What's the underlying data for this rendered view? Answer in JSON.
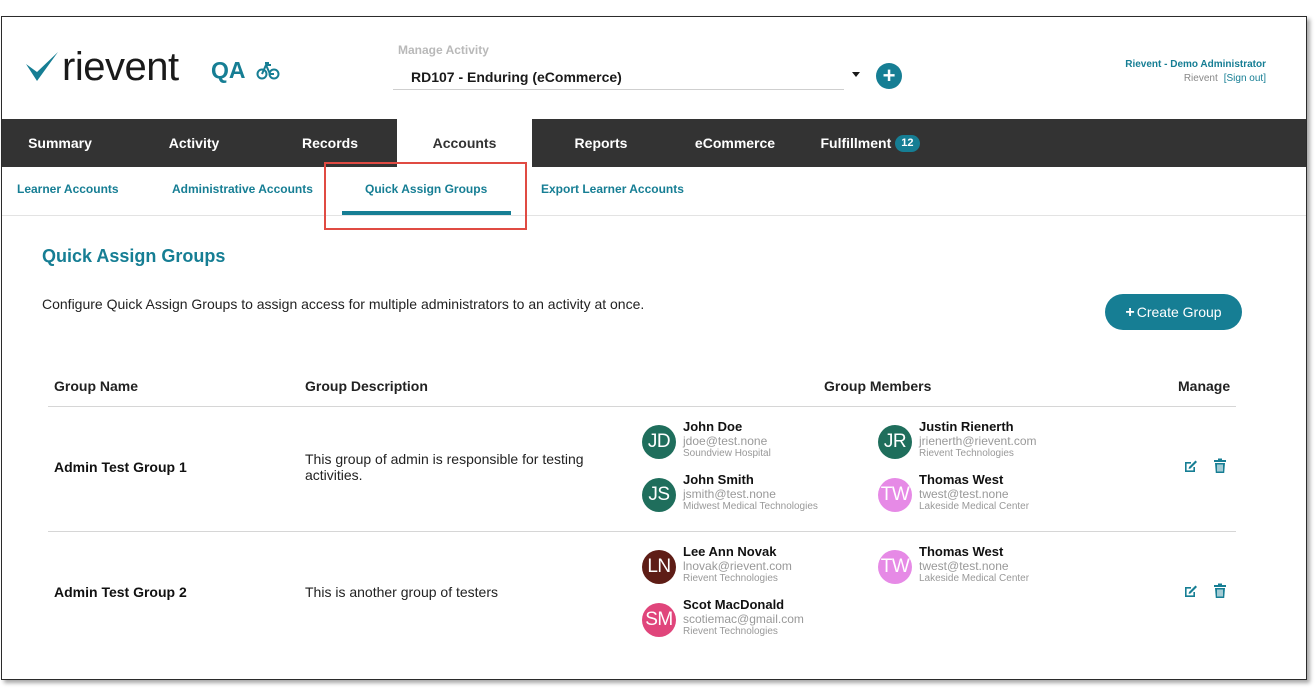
{
  "header": {
    "logo_text": "rievent",
    "environment": "QA",
    "activity_label": "Manage Activity",
    "activity_value": "RD107 - Enduring (eCommerce)",
    "user_name": "Rievent - Demo Administrator",
    "user_org": "Rievent",
    "signout": "[Sign out]"
  },
  "main_nav": {
    "tabs": [
      {
        "label": "Summary"
      },
      {
        "label": "Activity"
      },
      {
        "label": "Records"
      },
      {
        "label": "Accounts"
      },
      {
        "label": "Reports"
      },
      {
        "label": "eCommerce"
      },
      {
        "label": "Fulfillment",
        "badge": "12"
      }
    ],
    "active": "Accounts"
  },
  "sub_nav": {
    "tabs": [
      {
        "label": "Learner Accounts"
      },
      {
        "label": "Administrative Accounts"
      },
      {
        "label": "Quick Assign Groups"
      },
      {
        "label": "Export Learner Accounts"
      }
    ],
    "active": "Quick Assign Groups"
  },
  "content": {
    "title": "Quick Assign Groups",
    "description": "Configure Quick Assign Groups to assign access for multiple administrators to an activity at once.",
    "create_button": "Create Group",
    "table": {
      "headers": {
        "name": "Group Name",
        "description": "Group Description",
        "members": "Group Members",
        "manage": "Manage"
      },
      "rows": [
        {
          "name": "Admin Test Group 1",
          "description": "This group of admin is responsible for testing activities.",
          "members": [
            {
              "initials": "JD",
              "name": "John Doe",
              "email": "jdoe@test.none",
              "org": "Soundview Hospital",
              "color": "#1f6e5c"
            },
            {
              "initials": "JR",
              "name": "Justin Rienerth",
              "email": "jrienerth@rievent.com",
              "org": "Rievent Technologies",
              "color": "#1f6e5c"
            },
            {
              "initials": "JS",
              "name": "John Smith",
              "email": "jsmith@test.none",
              "org": "Midwest Medical Technologies",
              "color": "#1f6e5c"
            },
            {
              "initials": "TW",
              "name": "Thomas West",
              "email": "twest@test.none",
              "org": "Lakeside Medical Center",
              "color": "#e68ae6"
            }
          ]
        },
        {
          "name": "Admin Test Group 2",
          "description": "This is another group of testers",
          "members": [
            {
              "initials": "LN",
              "name": "Lee Ann Novak",
              "email": "lnovak@rievent.com",
              "org": "Rievent Technologies",
              "color": "#5e1d16"
            },
            {
              "initials": "TW",
              "name": "Thomas West",
              "email": "twest@test.none",
              "org": "Lakeside Medical Center",
              "color": "#e68ae6"
            },
            {
              "initials": "SM",
              "name": "Scot MacDonald",
              "email": "scotiemac@gmail.com",
              "org": "Rievent Technologies",
              "color": "#e0457b"
            }
          ]
        }
      ]
    }
  },
  "colors": {
    "accent": "#167e94",
    "nav_bg": "#333333",
    "highlight": "#e04b43"
  },
  "icons": {
    "edit": "edit-icon",
    "delete": "trash-icon",
    "environment": "bicycle-icon",
    "add": "plus-icon",
    "dropdown": "chevron-down-icon"
  }
}
